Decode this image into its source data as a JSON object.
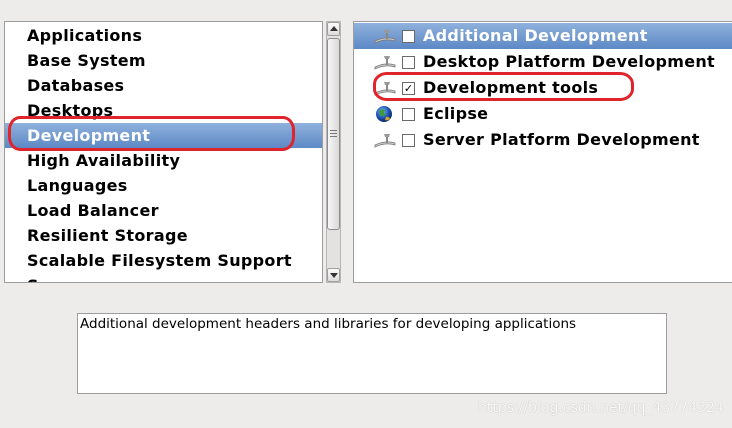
{
  "groups": {
    "items": [
      {
        "label": "Applications",
        "selected": false
      },
      {
        "label": "Base System",
        "selected": false
      },
      {
        "label": "Databases",
        "selected": false
      },
      {
        "label": "Desktops",
        "selected": false
      },
      {
        "label": "Development",
        "selected": true
      },
      {
        "label": "High Availability",
        "selected": false
      },
      {
        "label": "Languages",
        "selected": false
      },
      {
        "label": "Load Balancer",
        "selected": false
      },
      {
        "label": "Resilient Storage",
        "selected": false
      },
      {
        "label": "Scalable Filesystem Support",
        "selected": false
      },
      {
        "label": "Servers",
        "selected": false
      }
    ]
  },
  "packages": {
    "items": [
      {
        "label": "Additional Development",
        "checked": false,
        "selected": true,
        "icon": "package-icon"
      },
      {
        "label": "Desktop Platform Development",
        "checked": false,
        "selected": false,
        "icon": "package-icon"
      },
      {
        "label": "Development tools",
        "checked": true,
        "selected": false,
        "icon": "package-icon"
      },
      {
        "label": "Eclipse",
        "checked": false,
        "selected": false,
        "icon": "globe-icon"
      },
      {
        "label": "Server Platform Development",
        "checked": false,
        "selected": false,
        "icon": "package-icon"
      }
    ]
  },
  "description": {
    "text": "Additional development headers and libraries for developing applications"
  },
  "watermark": {
    "text": "https://blog.csdn.net/qq_43774324"
  },
  "colors": {
    "selection": "#5d89c6",
    "annotation": "#e0242b",
    "background": "#edeceb"
  }
}
